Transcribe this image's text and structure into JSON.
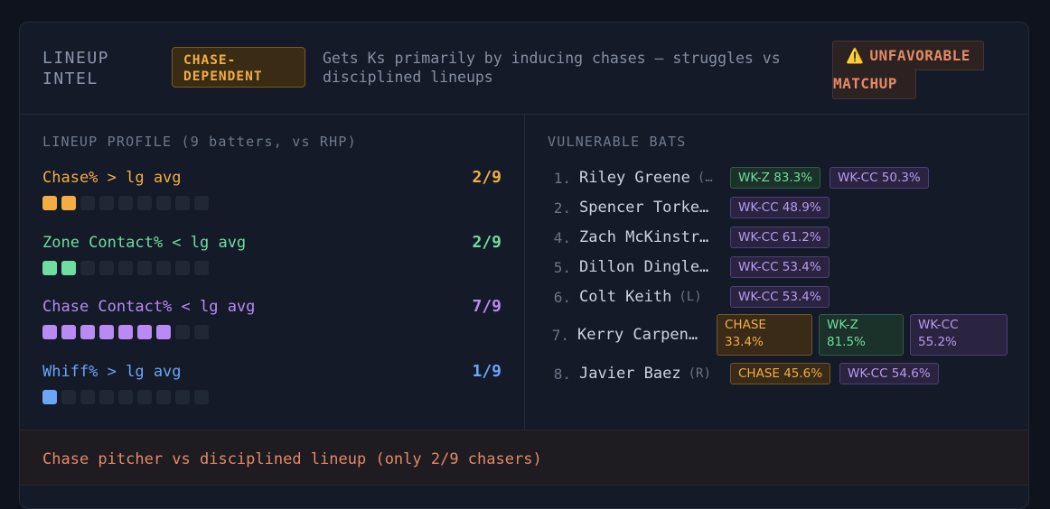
{
  "header": {
    "title": "LINEUP INTEL",
    "type_badge": "CHASE-DEPENDENT",
    "description": "Gets Ks primarily by inducing chases — struggles vs disciplined lineups",
    "warning_icon": "⚠️",
    "warning_line1": "UNFAVORABLE",
    "warning_line2": "MATCHUP"
  },
  "profile": {
    "label": "LINEUP PROFILE (9 batters, vs RHP)",
    "metrics": [
      {
        "name": "Chase% > lg avg",
        "count": "2/9",
        "filled": 2,
        "total": 9,
        "color": "#f2ad44"
      },
      {
        "name": "Zone Contact% < lg avg",
        "count": "2/9",
        "filled": 2,
        "total": 9,
        "color": "#6fdca0"
      },
      {
        "name": "Chase Contact% < lg avg",
        "count": "7/9",
        "filled": 7,
        "total": 9,
        "color": "#b98af3"
      },
      {
        "name": "Whiff% > lg avg",
        "count": "1/9",
        "filled": 1,
        "total": 9,
        "color": "#6aa5f8"
      }
    ]
  },
  "vulnerable": {
    "label": "VULNERABLE BATS",
    "bats": [
      {
        "num": "1.",
        "name": "Riley Greene",
        "hand": "(…",
        "tags": [
          "WK-Z 83.3%",
          "WK-CC 50.3%"
        ]
      },
      {
        "num": "2.",
        "name": "Spencer Torke…",
        "hand": "",
        "tags": [
          "WK-CC 48.9%"
        ]
      },
      {
        "num": "4.",
        "name": "Zach McKinstr…",
        "hand": "",
        "tags": [
          "WK-CC 61.2%"
        ]
      },
      {
        "num": "5.",
        "name": "Dillon Dingle…",
        "hand": "",
        "tags": [
          "WK-CC 53.4%"
        ]
      },
      {
        "num": "6.",
        "name": "Colt Keith",
        "hand": "(L)",
        "tags": [
          "WK-CC 53.4%"
        ]
      },
      {
        "num": "7.",
        "name": "Kerry Carpen…",
        "hand": "",
        "tags": [
          "CHASE 33.4%",
          "WK-Z 81.5%",
          "WK-CC 55.2%"
        ]
      },
      {
        "num": "8.",
        "name": "Javier Baez",
        "hand": "(R)",
        "tags": [
          "CHASE 45.6%",
          "WK-CC 54.6%"
        ]
      }
    ]
  },
  "footer": {
    "text": "Chase pitcher vs disciplined lineup (only 2/9 chasers)"
  }
}
